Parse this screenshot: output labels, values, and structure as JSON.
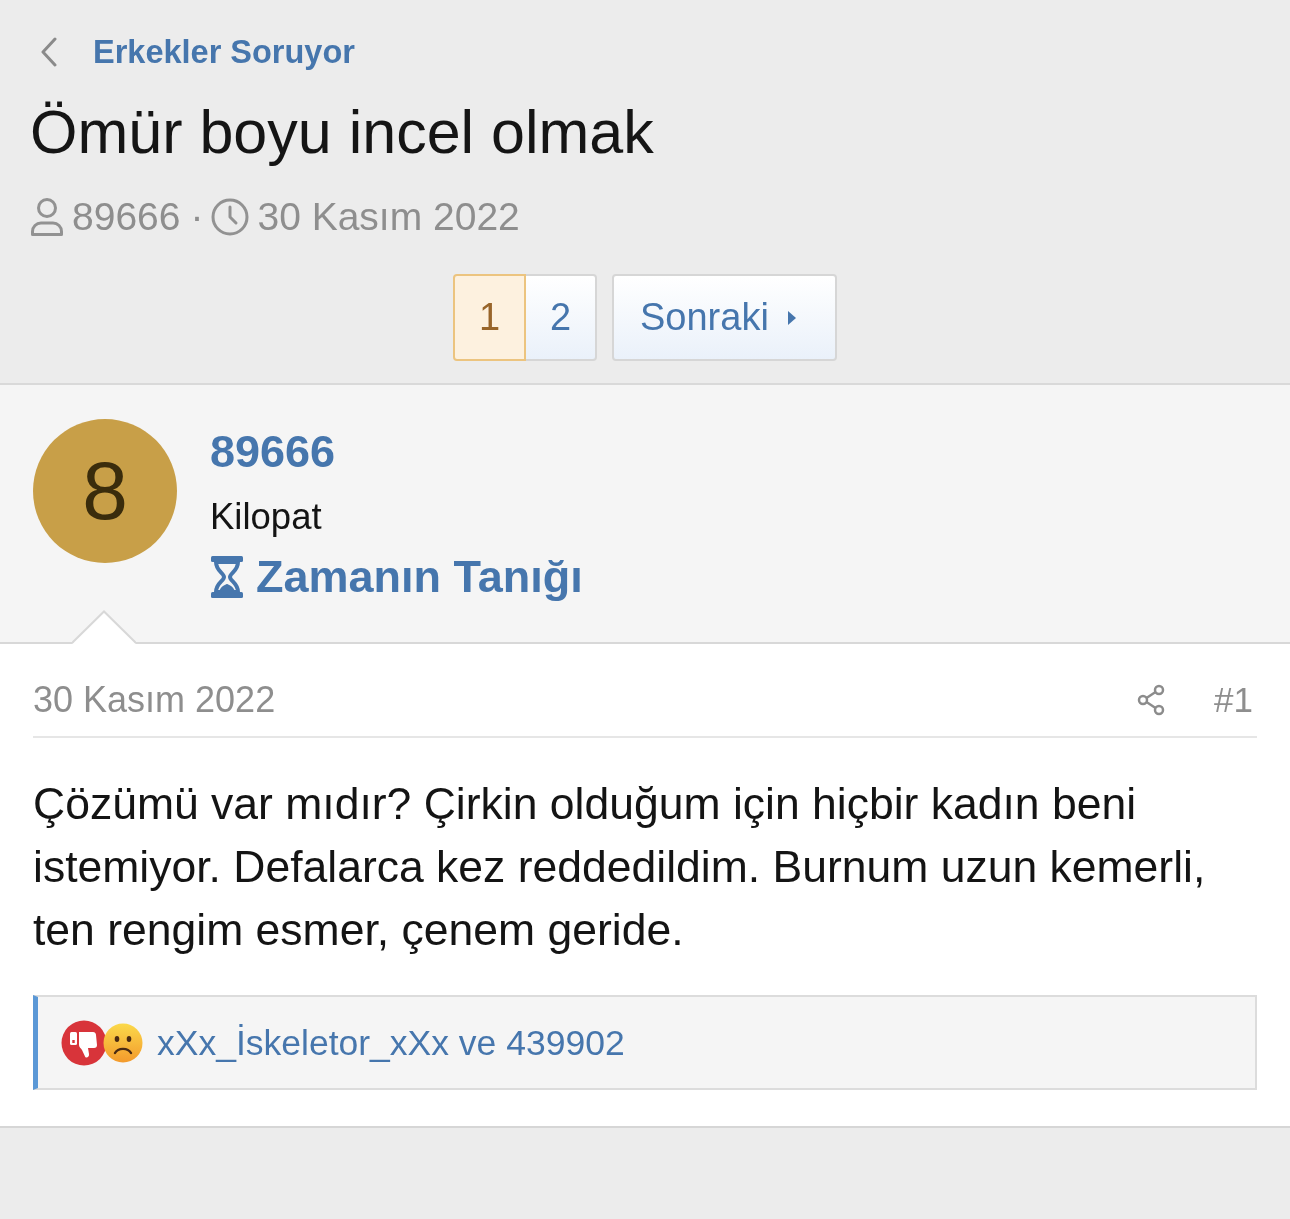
{
  "breadcrumb": {
    "label": "Erkekler Soruyor"
  },
  "thread": {
    "title": "Ömür boyu incel olmak",
    "author": "89666",
    "separator": "·",
    "date": "30 Kasım 2022"
  },
  "pagination": {
    "pages": [
      {
        "label": "1",
        "selected": true
      },
      {
        "label": "2",
        "selected": false
      }
    ],
    "next": "Sonraki"
  },
  "user": {
    "avatar_letter": "8",
    "name": "89666",
    "title": "Kilopat",
    "banner": "Zamanın Tanığı"
  },
  "post": {
    "date": "30 Kasım 2022",
    "number": "#1",
    "body": "Çözümü var mıdır? Çirkin olduğum için hiçbir kadın beni istemiyor. Defalarca kez reddedildim. Burnum uzun kemerli, ten rengim esmer, çenem geride.",
    "reactions": {
      "icons": [
        {
          "kind": "dislike"
        },
        {
          "kind": "sad"
        }
      ],
      "text": "xXx_İskeletor_xXx ve 439902"
    }
  }
}
